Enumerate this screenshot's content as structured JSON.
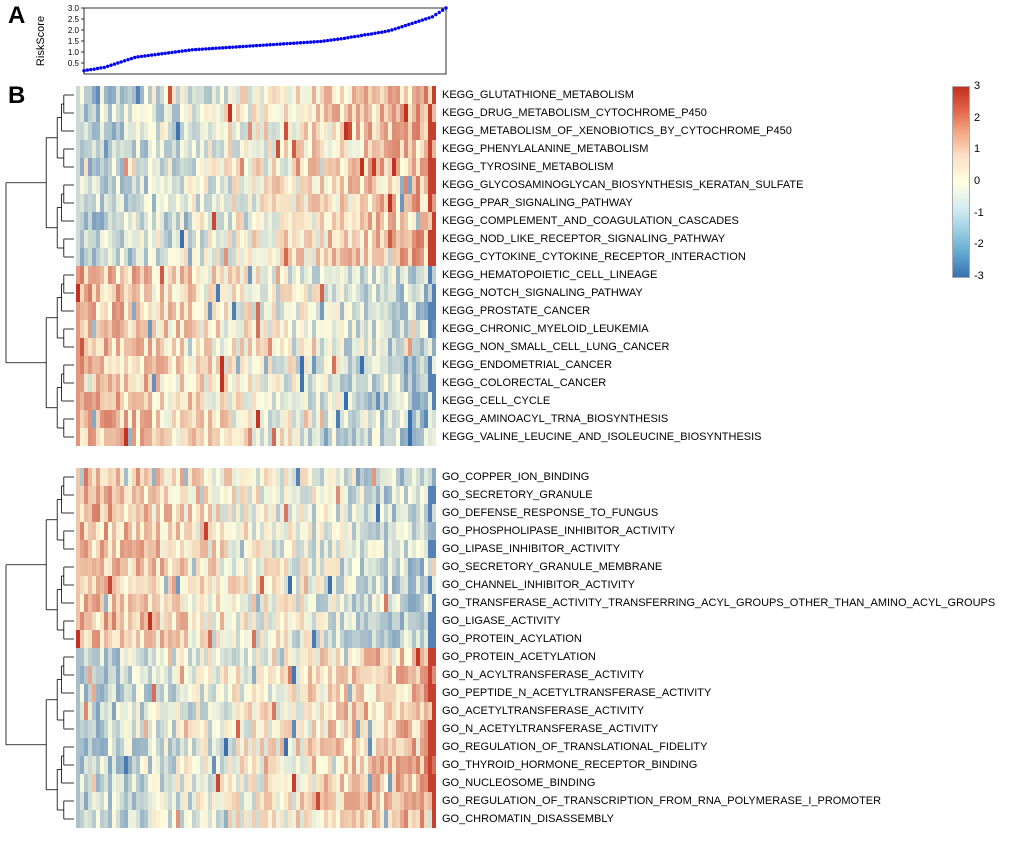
{
  "panel_labels": {
    "A": "A",
    "B": "B"
  },
  "scatter": {
    "ylabel": "RiskScore"
  },
  "legend": {
    "ticks": [
      "3",
      "2",
      "1",
      "0",
      "-1",
      "-2",
      "-3"
    ]
  },
  "kegg_rows": [
    "KEGG_GLUTATHIONE_METABOLISM",
    "KEGG_DRUG_METABOLISM_CYTOCHROME_P450",
    "KEGG_METABOLISM_OF_XENOBIOTICS_BY_CYTOCHROME_P450",
    "KEGG_PHENYLALANINE_METABOLISM",
    "KEGG_TYROSINE_METABOLISM",
    "KEGG_GLYCOSAMINOGLYCAN_BIOSYNTHESIS_KERATAN_SULFATE",
    "KEGG_PPAR_SIGNALING_PATHWAY",
    "KEGG_COMPLEMENT_AND_COAGULATION_CASCADES",
    "KEGG_NOD_LIKE_RECEPTOR_SIGNALING_PATHWAY",
    "KEGG_CYTOKINE_CYTOKINE_RECEPTOR_INTERACTION",
    "KEGG_HEMATOPOIETIC_CELL_LINEAGE",
    "KEGG_NOTCH_SIGNALING_PATHWAY",
    "KEGG_PROSTATE_CANCER",
    "KEGG_CHRONIC_MYELOID_LEUKEMIA",
    "KEGG_NON_SMALL_CELL_LUNG_CANCER",
    "KEGG_ENDOMETRIAL_CANCER",
    "KEGG_COLORECTAL_CANCER",
    "KEGG_CELL_CYCLE",
    "KEGG_AMINOACYL_TRNA_BIOSYNTHESIS",
    "KEGG_VALINE_LEUCINE_AND_ISOLEUCINE_BIOSYNTHESIS"
  ],
  "go_rows": [
    "GO_COPPER_ION_BINDING",
    "GO_SECRETORY_GRANULE",
    "GO_DEFENSE_RESPONSE_TO_FUNGUS",
    "GO_PHOSPHOLIPASE_INHIBITOR_ACTIVITY",
    "GO_LIPASE_INHIBITOR_ACTIVITY",
    "GO_SECRETORY_GRANULE_MEMBRANE",
    "GO_CHANNEL_INHIBITOR_ACTIVITY",
    "GO_TRANSFERASE_ACTIVITY_TRANSFERRING_ACYL_GROUPS_OTHER_THAN_AMINO_ACYL_GROUPS",
    "GO_LIGASE_ACTIVITY",
    "GO_PROTEIN_ACYLATION",
    "GO_PROTEIN_ACETYLATION",
    "GO_N_ACYLTRANSFERASE_ACTIVITY",
    "GO_PEPTIDE_N_ACETYLTRANSFERASE_ACTIVITY",
    "GO_ACETYLTRANSFERASE_ACTIVITY",
    "GO_N_ACETYLTRANSFERASE_ACTIVITY",
    "GO_REGULATION_OF_TRANSLATIONAL_FIDELITY",
    "GO_THYROID_HORMONE_RECEPTOR_BINDING",
    "GO_NUCLEOSOME_BINDING",
    "GO_REGULATION_OF_TRANSCRIPTION_FROM_RNA_POLYMERASE_I_PROMOTER",
    "GO_CHROMATIN_DISASSEMBLY"
  ],
  "chart_data": [
    {
      "type": "scatter",
      "panel": "A",
      "title": "",
      "xlabel": "",
      "ylabel": "RiskScore",
      "ylim": [
        0,
        3.0
      ],
      "yticks": [
        0.5,
        1.0,
        1.5,
        2.0,
        2.5,
        3.0
      ],
      "n_points_estimated": 120,
      "description": "Samples ordered by RiskScore (monotone increasing)",
      "x_range": [
        1,
        120
      ],
      "y_samples_estimated": [
        0.15,
        0.18,
        0.2,
        0.22,
        0.25,
        0.28,
        0.3,
        0.35,
        0.4,
        0.45,
        0.5,
        0.55,
        0.6,
        0.65,
        0.7,
        0.75,
        0.78,
        0.8,
        0.82,
        0.84,
        0.86,
        0.88,
        0.9,
        0.92,
        0.94,
        0.96,
        0.98,
        1.0,
        1.02,
        1.04,
        1.06,
        1.08,
        1.1,
        1.11,
        1.12,
        1.13,
        1.14,
        1.15,
        1.16,
        1.17,
        1.18,
        1.19,
        1.2,
        1.21,
        1.22,
        1.23,
        1.24,
        1.25,
        1.26,
        1.27,
        1.28,
        1.29,
        1.3,
        1.31,
        1.32,
        1.33,
        1.34,
        1.35,
        1.36,
        1.37,
        1.38,
        1.39,
        1.4,
        1.41,
        1.42,
        1.43,
        1.44,
        1.45,
        1.46,
        1.47,
        1.48,
        1.5,
        1.52,
        1.54,
        1.56,
        1.58,
        1.6,
        1.62,
        1.65,
        1.68,
        1.7,
        1.72,
        1.75,
        1.78,
        1.8,
        1.82,
        1.85,
        1.88,
        1.9,
        1.93,
        1.96,
        2.0,
        2.05,
        2.1,
        2.15,
        2.2,
        2.25,
        2.3,
        2.35,
        2.4,
        2.45,
        2.5,
        2.55,
        2.6,
        2.7,
        2.8,
        2.9,
        3.0
      ]
    },
    {
      "type": "heatmap",
      "panel": "B",
      "subset": "KEGG",
      "columns": "samples ordered by RiskScore (same order as panel A)",
      "rows": "see kegg_rows",
      "value_range": [
        -3,
        3
      ],
      "colorbar_ticks": [
        3,
        2,
        1,
        0,
        -1,
        -2,
        -3
      ],
      "description": "GSVA/ssGSEA-style enrichment z-scores per sample for KEGG pathways; warm colors at high-RiskScore end for top cluster, cool for bottom cluster; row dendrogram at left."
    },
    {
      "type": "heatmap",
      "panel": "B",
      "subset": "GO",
      "columns": "samples ordered by RiskScore (same order as panel A)",
      "rows": "see go_rows",
      "value_range": [
        -3,
        3
      ],
      "colorbar_ticks": [
        3,
        2,
        1,
        0,
        -1,
        -2,
        -3
      ],
      "description": "Enrichment z-scores per sample for GO terms; top cluster trends warm-to-cool left-to-right with strong red spikes on right edge for several rows; bottom cluster trends opposite; row dendrogram at left."
    }
  ]
}
